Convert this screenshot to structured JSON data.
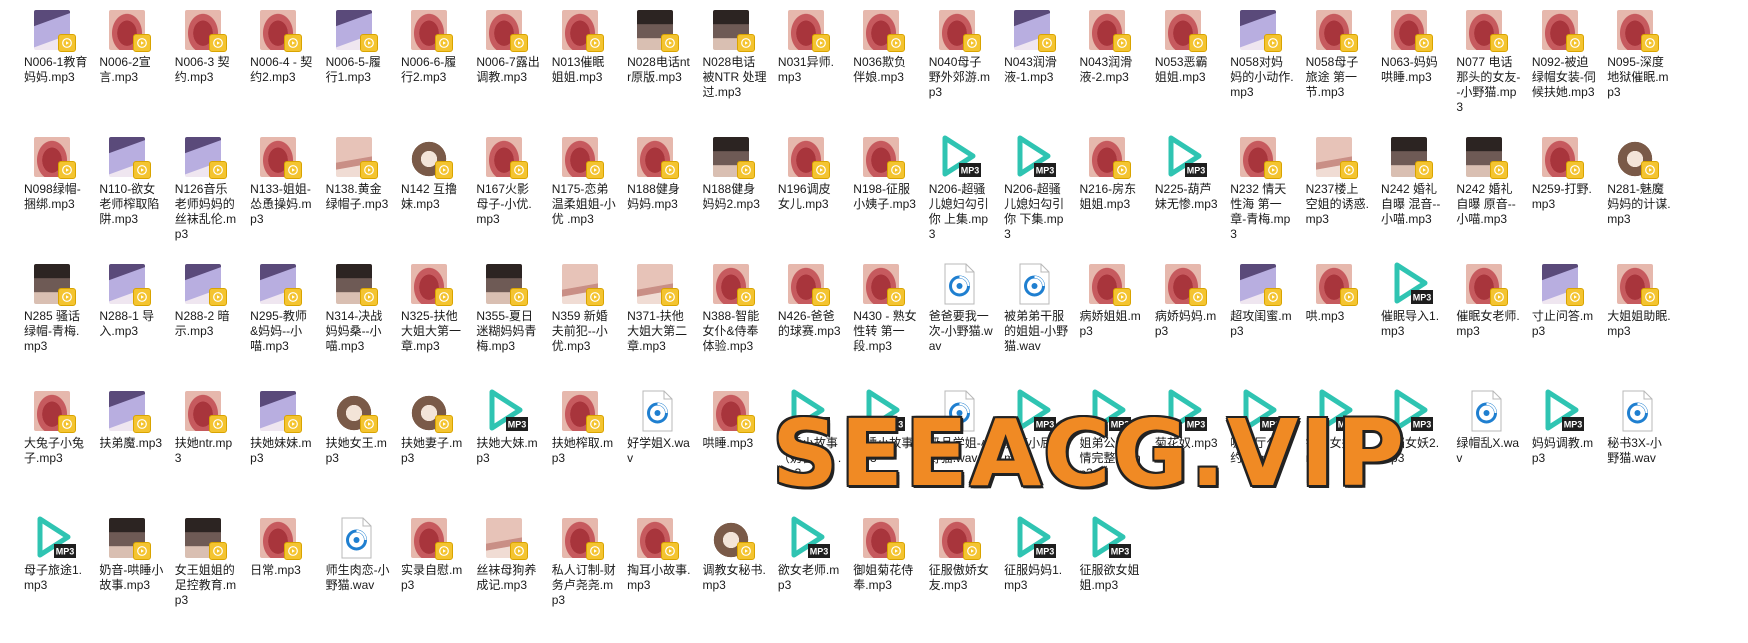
{
  "files": [
    {
      "name": "N006-1教育妈妈.mp3",
      "thumb": "anime"
    },
    {
      "name": "N006-2宣言.mp3",
      "thumb": "lips"
    },
    {
      "name": "N006-3 契约.mp3",
      "thumb": "lips"
    },
    {
      "name": "N006-4 - 契约2.mp3",
      "thumb": "lips"
    },
    {
      "name": "N006-5-履行1.mp3",
      "thumb": "anime"
    },
    {
      "name": "N006-6-履行2.mp3",
      "thumb": "lips"
    },
    {
      "name": "N006-7露出调教.mp3",
      "thumb": "lips"
    },
    {
      "name": "N013催眠姐姐.mp3",
      "thumb": "lips"
    },
    {
      "name": "N028电话ntr原版.mp3",
      "thumb": "photo"
    },
    {
      "name": "N028电话被NTR 处理过.mp3",
      "thumb": "photo"
    },
    {
      "name": "N031异师.mp3",
      "thumb": "lips"
    },
    {
      "name": "N036欺负伴娘.mp3",
      "thumb": "lips"
    },
    {
      "name": "N040母子野外郊游.mp3",
      "thumb": "lips"
    },
    {
      "name": "N043润滑液-1.mp3",
      "thumb": "anime"
    },
    {
      "name": "N043润滑液-2.mp3",
      "thumb": "lips"
    },
    {
      "name": "N053恶霸姐姐.mp3",
      "thumb": "lips"
    },
    {
      "name": "N058对妈妈的小动作.mp3",
      "thumb": "anime"
    },
    {
      "name": "N058母子旅途 第一节.mp3",
      "thumb": "lips"
    },
    {
      "name": "N063-妈妈哄睡.mp3",
      "thumb": "lips"
    },
    {
      "name": "N077 电话那头的女友--小野猫.mp3",
      "thumb": "lips"
    },
    {
      "name": "N092-被迫绿帽女装-伺候扶她.mp3",
      "thumb": "lips"
    },
    {
      "name": "N095-深度地狱催眠.mp3",
      "thumb": "lips"
    },
    {
      "name": "N098绿帽-捆绑.mp3",
      "thumb": "lips"
    },
    {
      "name": "N110-欲女老师榨取陷阱.mp3",
      "thumb": "anime"
    },
    {
      "name": "N126音乐老师妈妈的丝袜乱伦.mp3",
      "thumb": "anime"
    },
    {
      "name": "N133-姐姐-怂恿操妈.mp3",
      "thumb": "lips"
    },
    {
      "name": "N138.黄金绿帽子.mp3",
      "thumb": "skin"
    },
    {
      "name": "N142 互撸妹.mp3",
      "thumb": "catgirl"
    },
    {
      "name": "N167火影母子-小优.mp3",
      "thumb": "lips"
    },
    {
      "name": "N175-恋弟温柔姐姐-小优 .mp3",
      "thumb": "lips"
    },
    {
      "name": "N188健身妈妈.mp3",
      "thumb": "lips"
    },
    {
      "name": "N188健身妈妈2.mp3",
      "thumb": "photo"
    },
    {
      "name": "N196调皮女儿.mp3",
      "thumb": "lips"
    },
    {
      "name": "N198-征服小姨子.mp3",
      "thumb": "lips"
    },
    {
      "name": "N206-超骚儿媳妇勾引你 上集.mp3",
      "thumb": "mp3"
    },
    {
      "name": "N206-超骚儿媳妇勾引你 下集.mp3",
      "thumb": "mp3"
    },
    {
      "name": "N216-房东姐姐.mp3",
      "thumb": "lips"
    },
    {
      "name": "N225-葫芦妹无惨.mp3",
      "thumb": "mp3"
    },
    {
      "name": "N232 情天性海 第一章-青梅.mp3",
      "thumb": "lips"
    },
    {
      "name": "N237楼上空姐的诱惑.mp3",
      "thumb": "skin"
    },
    {
      "name": "N242 婚礼自曝 混音--小喵.mp3",
      "thumb": "photo"
    },
    {
      "name": "N242 婚礼自曝 原音--小喵.mp3",
      "thumb": "photo"
    },
    {
      "name": "N259-打野.mp3",
      "thumb": "lips"
    },
    {
      "name": "N281-魅魔妈妈的计谋.mp3",
      "thumb": "catgirl"
    },
    {
      "name": "N285 骚话绿帽-青梅.mp3",
      "thumb": "photo"
    },
    {
      "name": "N288-1 导入.mp3",
      "thumb": "anime"
    },
    {
      "name": "N288-2 暗示.mp3",
      "thumb": "anime"
    },
    {
      "name": "N295-教师&妈妈--小喵.mp3",
      "thumb": "anime"
    },
    {
      "name": "N314-决战妈妈桑--小喵.mp3",
      "thumb": "photo"
    },
    {
      "name": "N325-扶他大姐大第一章.mp3",
      "thumb": "lips"
    },
    {
      "name": "N355-夏日迷糊妈妈青梅.mp3",
      "thumb": "photo"
    },
    {
      "name": "N359 新婚夫前犯--小优.mp3",
      "thumb": "skin"
    },
    {
      "name": "N371-扶他大姐大第二章.mp3",
      "thumb": "skin"
    },
    {
      "name": "N388-智能女仆&侍奉体验.mp3",
      "thumb": "lips"
    },
    {
      "name": "N426-爸爸的球赛.mp3",
      "thumb": "lips"
    },
    {
      "name": "N430 - 熟女性转 第一段.mp3",
      "thumb": "lips"
    },
    {
      "name": "爸爸要我一次-小野猫.wav",
      "thumb": "wav"
    },
    {
      "name": "被弟弟干服的姐姐-小野猫.wav",
      "thumb": "wav"
    },
    {
      "name": "病娇姐姐.mp3",
      "thumb": "lips"
    },
    {
      "name": "病娇妈妈.mp3",
      "thumb": "lips"
    },
    {
      "name": "超攻闺蜜.mp3",
      "thumb": "anime"
    },
    {
      "name": "哄.mp3",
      "thumb": "lips"
    },
    {
      "name": "催眠导入1.mp3",
      "thumb": "mp3"
    },
    {
      "name": "催眠女老师.mp3",
      "thumb": "lips"
    },
    {
      "name": "寸止问答.mp3",
      "thumb": "anime"
    },
    {
      "name": "大姐姐助眠.mp3",
      "thumb": "lips"
    },
    {
      "name": "大兔子小兔子.mp3",
      "thumb": "lips"
    },
    {
      "name": "扶弟魔.mp3",
      "thumb": "anime"
    },
    {
      "name": "扶她ntr.mp3",
      "thumb": "lips"
    },
    {
      "name": "扶她妹妹.mp3",
      "thumb": "anime"
    },
    {
      "name": "扶她女王.mp3",
      "thumb": "catgirl"
    },
    {
      "name": "扶她妻子.mp3",
      "thumb": "catgirl"
    },
    {
      "name": "扶她大妹.mp3",
      "thumb": "mp3"
    },
    {
      "name": "扶她榨取.mp3",
      "thumb": "lips"
    },
    {
      "name": "好学姐X.wav",
      "thumb": "wav"
    },
    {
      "name": "哄睡.mp3",
      "thumb": "lips"
    },
    {
      "name": "哄睡小故事（奶音版）.mp3",
      "thumb": "mp3"
    },
    {
      "name": "哄睡小故事.mp3",
      "thumb": "mp3"
    },
    {
      "name": "极品学姐-小野猫.wav",
      "thumb": "wav"
    },
    {
      "name": "教育小屁孩.mp3",
      "thumb": "mp3"
    },
    {
      "name": "姐弟公开偷情完整版.mp3",
      "thumb": "mp3"
    },
    {
      "name": "菊花奴.mp3",
      "thumb": "mp3"
    },
    {
      "name": "咖啡厅公开约炮.mp3",
      "thumb": "mp3"
    },
    {
      "name": "铃铛女妖1.mp3",
      "thumb": "mp3"
    },
    {
      "name": "铃铛女妖2.mp3",
      "thumb": "mp3"
    },
    {
      "name": "绿帽乱X.wav",
      "thumb": "wav"
    },
    {
      "name": "妈妈调教.mp3",
      "thumb": "mp3"
    },
    {
      "name": "秘书3X-小野猫.wav",
      "thumb": "wav"
    },
    {
      "name": "母子旅途1.mp3",
      "thumb": "mp3"
    },
    {
      "name": "奶音-哄睡小故事.mp3",
      "thumb": "photo"
    },
    {
      "name": "女王姐姐的足控教育.mp3",
      "thumb": "photo"
    },
    {
      "name": "日常.mp3",
      "thumb": "lips"
    },
    {
      "name": "师生肉恋-小野猫.wav",
      "thumb": "wav"
    },
    {
      "name": "实录自慰.mp3",
      "thumb": "lips"
    },
    {
      "name": "丝袜母狗养成记.mp3",
      "thumb": "skin"
    },
    {
      "name": "私人订制-财务卢尧尧.mp3",
      "thumb": "lips"
    },
    {
      "name": "掏耳小故事.mp3",
      "thumb": "lips"
    },
    {
      "name": "调教女秘书.mp3",
      "thumb": "catgirl"
    },
    {
      "name": "欲女老师.mp3",
      "thumb": "mp3"
    },
    {
      "name": "御姐菊花侍奉.mp3",
      "thumb": "lips"
    },
    {
      "name": "征服傲娇女友.mp3",
      "thumb": "lips"
    },
    {
      "name": "征服妈妈1.mp3",
      "thumb": "mp3"
    },
    {
      "name": "征服欲女姐姐.mp3",
      "thumb": "mp3"
    }
  ],
  "watermark": {
    "text": "SEEACG.VIP"
  },
  "colors": {
    "lips": "#c65a5e",
    "anime": "#b8aee0",
    "photo": "#6e5a55",
    "skin": "#e7c3b8",
    "catgirl": "#7a5a48",
    "play": "#2fc4b2",
    "wav": "#1f7fd0",
    "badge": "#f4c430"
  }
}
